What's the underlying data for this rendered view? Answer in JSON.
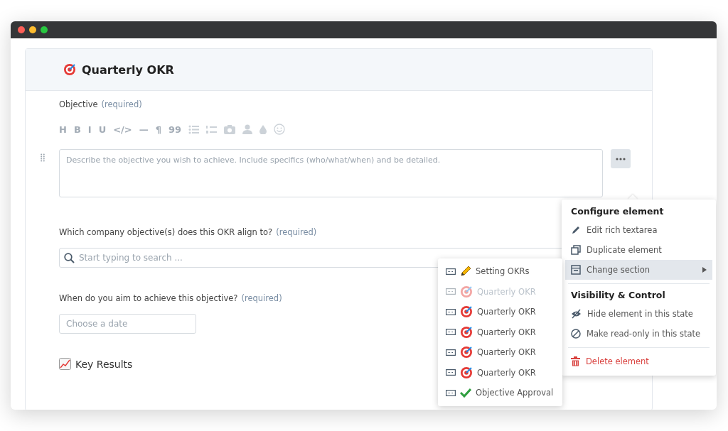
{
  "form": {
    "title": "Quarterly OKR",
    "fields": [
      {
        "kind": "richtext",
        "label": "Objective",
        "required_note": "(required)",
        "placeholder": "Describe the objective you wish to achieve. Include specifics (who/what/when) and be detailed.",
        "toolbar": [
          {
            "kind": "glyph",
            "text": "H"
          },
          {
            "kind": "glyph",
            "text": "B"
          },
          {
            "kind": "glyph",
            "text": "I"
          },
          {
            "kind": "glyph",
            "text": "U"
          },
          {
            "kind": "glyph",
            "text": "</>"
          },
          {
            "kind": "glyph",
            "text": "—"
          },
          {
            "kind": "glyph",
            "text": "¶"
          },
          {
            "kind": "glyph",
            "text": "99"
          },
          {
            "kind": "bullets"
          },
          {
            "kind": "numbers"
          },
          {
            "kind": "camera"
          },
          {
            "kind": "person"
          },
          {
            "kind": "drop"
          },
          {
            "kind": "smile"
          }
        ]
      },
      {
        "kind": "search",
        "label": "Which company objective(s) does this OKR align to?",
        "required_note": "(required)",
        "placeholder": "Start typing to search ..."
      },
      {
        "kind": "date",
        "label": "When do you aim to achieve this objective?",
        "required_note": "(required)",
        "placeholder": "Choose a date"
      }
    ],
    "section_heading": "Key Results"
  },
  "context_menu": {
    "groups": [
      {
        "heading": "Configure element",
        "items": [
          {
            "kind": "pencil",
            "label": "Edit rich textarea",
            "selected": false,
            "danger": false,
            "submenu": false
          },
          {
            "kind": "duplicate",
            "label": "Duplicate element",
            "selected": false,
            "danger": false,
            "submenu": false
          },
          {
            "kind": "section",
            "label": "Change section",
            "selected": true,
            "danger": false,
            "submenu": true
          }
        ]
      },
      {
        "heading": "Visibility & Control",
        "items": [
          {
            "kind": "eye-off",
            "label": "Hide element in this state",
            "selected": false,
            "danger": false,
            "submenu": false
          },
          {
            "kind": "block",
            "label": "Make read-only in this state",
            "selected": false,
            "danger": false,
            "submenu": false
          }
        ]
      },
      {
        "items": [
          {
            "kind": "trash",
            "label": "Delete element",
            "selected": false,
            "danger": true,
            "submenu": false
          }
        ]
      }
    ]
  },
  "section_menu": {
    "items": [
      {
        "kind": "pencil",
        "label": "Setting OKRs",
        "disabled": false
      },
      {
        "kind": "target",
        "label": "Quarterly OKR",
        "disabled": true
      },
      {
        "kind": "target",
        "label": "Quarterly OKR",
        "disabled": false
      },
      {
        "kind": "target",
        "label": "Quarterly OKR",
        "disabled": false
      },
      {
        "kind": "target",
        "label": "Quarterly OKR",
        "disabled": false
      },
      {
        "kind": "target",
        "label": "Quarterly OKR",
        "disabled": false
      },
      {
        "kind": "check",
        "label": "Objective Approval",
        "disabled": false
      }
    ]
  }
}
